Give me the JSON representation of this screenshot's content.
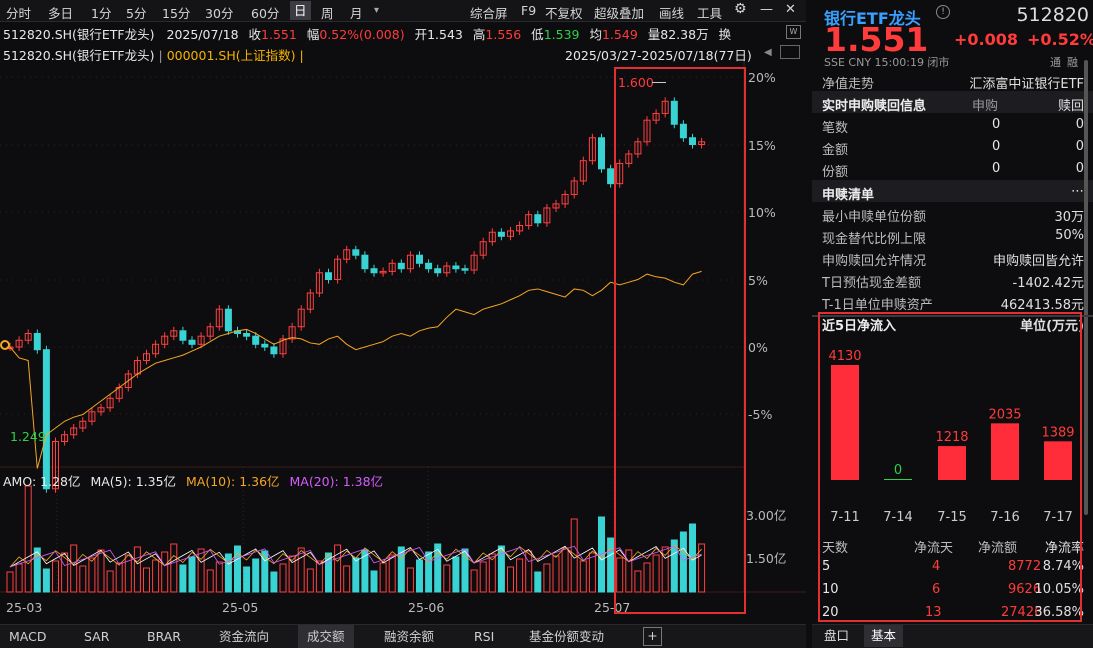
{
  "toolbar": {
    "periods": [
      "分时",
      "多日",
      "1分",
      "5分",
      "15分",
      "30分",
      "60分",
      "日",
      "周",
      "月"
    ],
    "right": [
      "综合屏",
      "F9",
      "不复权",
      "超级叠加",
      "画线",
      "工具"
    ],
    "active": "日"
  },
  "info": {
    "date": "2025/07/18",
    "close_label": "收",
    "close": "1.551",
    "chg_label": "幅",
    "chg": "0.52%(0.008)",
    "open_label": "开",
    "open": "1.543",
    "high_label": "高",
    "high": "1.556",
    "low_label": "低",
    "low": "1.539",
    "avg_label": "均",
    "avg": "1.549",
    "vol_label": "量",
    "vol": "82.38万",
    "swap": "换"
  },
  "legend": {
    "main": "512820.SH(银行ETF龙头)",
    "compare": "000001.SH(上证指数)",
    "range": "2025/03/27-2025/07/18(77日)"
  },
  "price_axis": [
    "20%",
    "15%",
    "10%",
    "5%",
    "0%",
    "-5%"
  ],
  "annot": {
    "high": "1.600",
    "low": "1.249"
  },
  "vol_legend": {
    "amo": "AMO: 1.28亿",
    "ma5": "MA(5): 1.35亿",
    "ma10": "MA(10): 1.36亿",
    "ma20": "MA(20): 1.38亿"
  },
  "vol_axis": [
    "3.00亿",
    "1.50亿"
  ],
  "date_axis": [
    "25-03",
    "25-05",
    "25-06",
    "25-07"
  ],
  "tabs": [
    "MACD",
    "SAR",
    "BRAR",
    "资金流向",
    "成交额",
    "融资余额",
    "RSI",
    "基金份额变动"
  ],
  "active_tab": "成交额",
  "quote": {
    "name": "银行ETF龙头",
    "code": "512820",
    "price": "1.551",
    "chg": "+0.008",
    "pct": "+0.52%",
    "meta": "SSE  CNY  15:00:19  闭市",
    "tong": "通",
    "rong": "融"
  },
  "nav": {
    "label": "净值走势",
    "value": "汇添富中证银行ETF"
  },
  "realtime": {
    "title": "实时申购赎回信息",
    "col1": "申购",
    "col2": "赎回",
    "rows": [
      {
        "k": "笔数",
        "a": "0",
        "b": "0"
      },
      {
        "k": "金额",
        "a": "0",
        "b": "0"
      },
      {
        "k": "份额",
        "a": "0",
        "b": "0"
      }
    ]
  },
  "list": {
    "title": "申赎清单",
    "rows": [
      {
        "k": "最小申赎单位份额",
        "v": "30万"
      },
      {
        "k": "现金替代比例上限",
        "v": "50%"
      },
      {
        "k": "申购赎回允许情况",
        "v": "申购赎回皆允许"
      },
      {
        "k": "T日预估现金差额",
        "v": "-1402.42元"
      },
      {
        "k": "T-1日单位申赎资产",
        "v": "462413.58元"
      }
    ]
  },
  "flow": {
    "title": "近5日净流入",
    "unit": "单位(万元)",
    "days_h": "天数",
    "c1": "净流天",
    "c2": "净流额",
    "c3": "净流率",
    "rows": [
      {
        "d": "5",
        "a": "4",
        "b": "8772",
        "c": "8.74%"
      },
      {
        "d": "10",
        "a": "6",
        "b": "9626",
        "c": "10.05%"
      },
      {
        "d": "20",
        "a": "13",
        "b": "27426",
        "c": "36.58%"
      }
    ]
  },
  "bottom_tabs": [
    "盘口",
    "基本"
  ],
  "chart_data": [
    {
      "type": "bar",
      "title": "近5日净流入",
      "ylabel": "单位(万元)",
      "categories": [
        "7-11",
        "7-14",
        "7-15",
        "7-16",
        "7-17"
      ],
      "values": [
        4130,
        0,
        1218,
        2035,
        1389
      ],
      "color": "#ff2d3a"
    },
    {
      "type": "line",
      "title": "512820.SH(银行ETF龙头) 日K",
      "x_range": [
        "2025/03/27",
        "2025/07/18"
      ],
      "y_axis": "pct change",
      "ylim": [
        "-5%",
        "20%"
      ],
      "series": [
        {
          "name": "512820.SH(银行ETF龙头)",
          "note": "candlestick",
          "high": 1.6,
          "low": 1.249,
          "close": 1.551
        },
        {
          "name": "000001.SH(上证指数)",
          "color": "#f5a623"
        }
      ]
    }
  ]
}
